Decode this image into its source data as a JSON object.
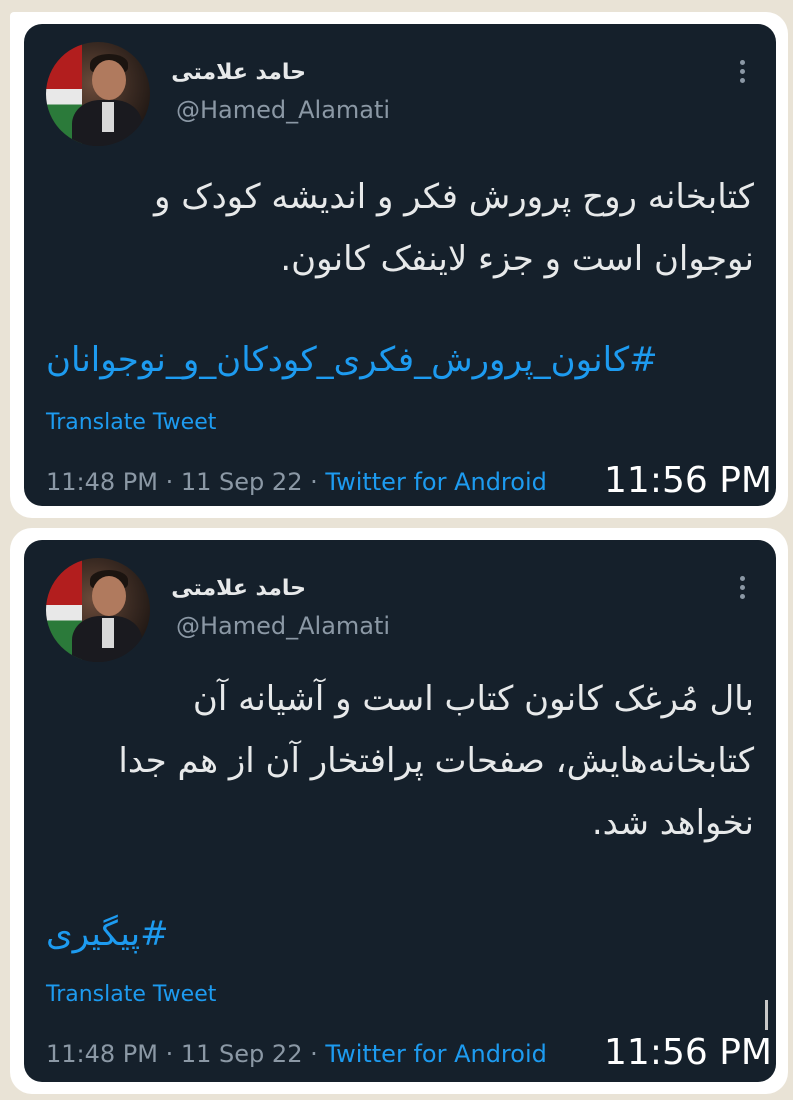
{
  "tweets": [
    {
      "name": "حامد علامتی",
      "handle": "@Hamed_Alamati",
      "text_line1": "کتابخانه روح پرورش فکر و اندیشه کودک و",
      "text_line2": "نوجوان است و جزء لاینفک کانون.",
      "text_line3": "",
      "hashtag": "#کانون_پرورش_فکری_کودکان_و_نوجوانان",
      "translate": "Translate Tweet",
      "time": "11:48 PM",
      "date": "11 Sep 22",
      "client": "Twitter for Android",
      "message_time": "11:56 PM"
    },
    {
      "name": "حامد علامتی",
      "handle": "@Hamed_Alamati",
      "text_line1": "بال مُرغک کانون کتاب است و آشیانه آن",
      "text_line2": "کتابخانه‌هایش، صفحات پرافتخار آن از هم جدا",
      "text_line3": "نخواهد شد.",
      "hashtag": "#پیگیری",
      "translate": "Translate Tweet",
      "time": "11:48 PM",
      "date": "11 Sep 22",
      "client": "Twitter for Android",
      "message_time": "11:56 PM"
    }
  ],
  "colors": {
    "chat_background": "#e9e3d6",
    "card_background": "#15202b",
    "link_blue": "#1d9bf0",
    "muted_gray": "#8b98a5"
  },
  "icons": {
    "more": "vertical-ellipsis-icon",
    "avatar": "profile-photo"
  }
}
